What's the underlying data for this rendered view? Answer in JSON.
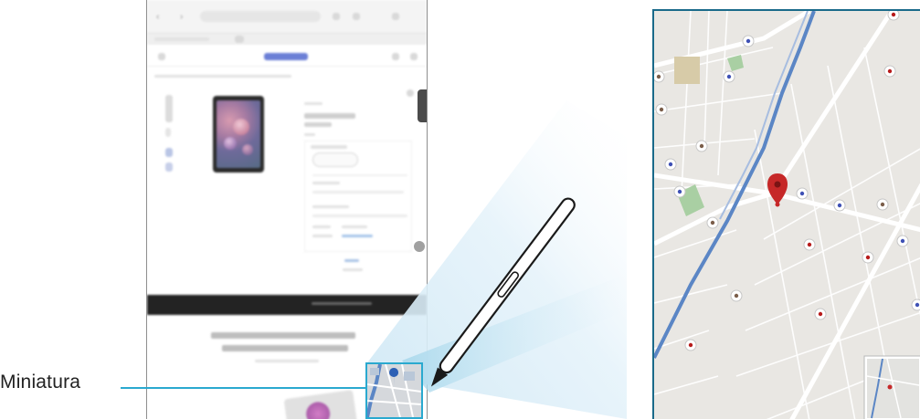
{
  "callout": {
    "label": "Miniatura"
  },
  "icons": {
    "pen": "s-pen-icon",
    "pin": "map-pin-icon",
    "back": "back-icon",
    "forward": "forward-icon",
    "tabs": "tabs-icon",
    "menu": "menu-icon"
  },
  "colors": {
    "accent": "#2aa9cf",
    "pin": "#c62828",
    "river": "#5b86c5",
    "map_bg": "#e8e6e2"
  }
}
